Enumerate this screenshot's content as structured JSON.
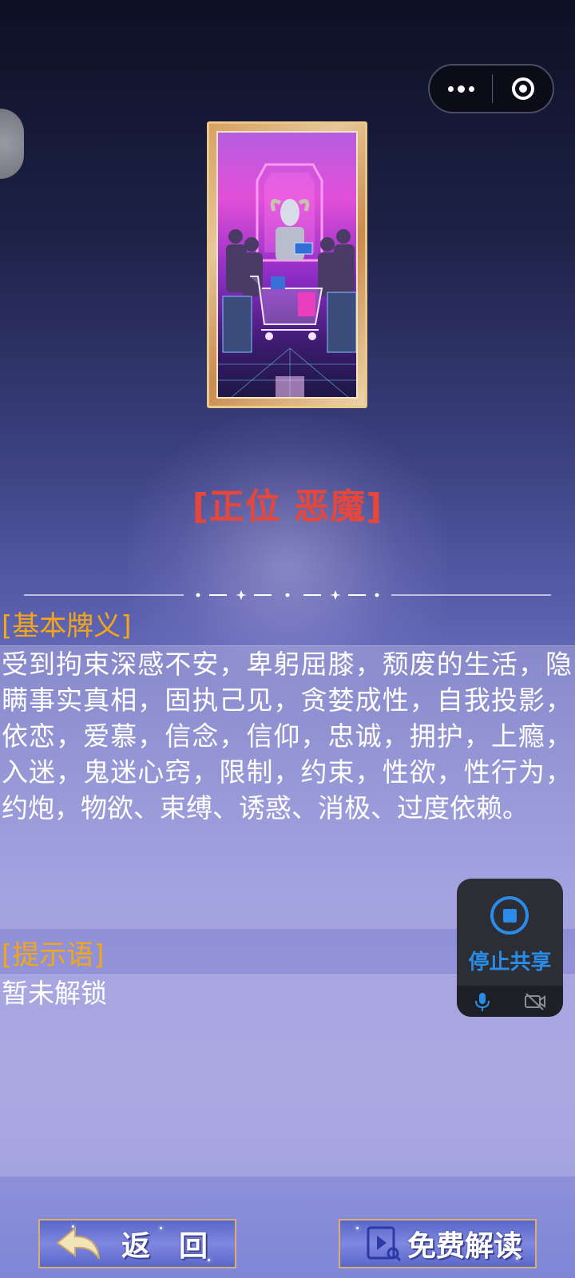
{
  "header": {
    "capsule_more_icon": "more-dots-icon",
    "capsule_close_icon": "target-circle-icon"
  },
  "card": {
    "image_icon": "devil-tarot-card-image",
    "title": "[正位 恶魔]"
  },
  "basic_meaning": {
    "label": "[基本牌义]",
    "text": "受到拘束深感不安，卑躬屈膝，颓废的生活，隐瞒事实真相，固执己见，贪婪成性，自我投影，依恋，爱慕，信念，信仰，忠诚，拥护，上瘾，入迷，鬼迷心窍，限制，约束，性欲，性行为，约炮，物欲、束缚、诱惑、消极、过度依赖。"
  },
  "hint": {
    "label": "[提示语]",
    "text": "暂未解锁"
  },
  "screen_share": {
    "stop_label": "停止共享",
    "stop_icon": "stop-circle-icon",
    "mic_icon": "microphone-icon",
    "camera_off_icon": "camera-off-icon",
    "accent_color": "#2a8ce8"
  },
  "buttons": {
    "back_label": "返　回",
    "back_icon": "back-arrow-icon",
    "free_reading_label": "免费解读",
    "free_reading_icon": "video-search-icon"
  },
  "colors": {
    "title_red": "#e5473d",
    "label_orange": "#f3a619"
  }
}
